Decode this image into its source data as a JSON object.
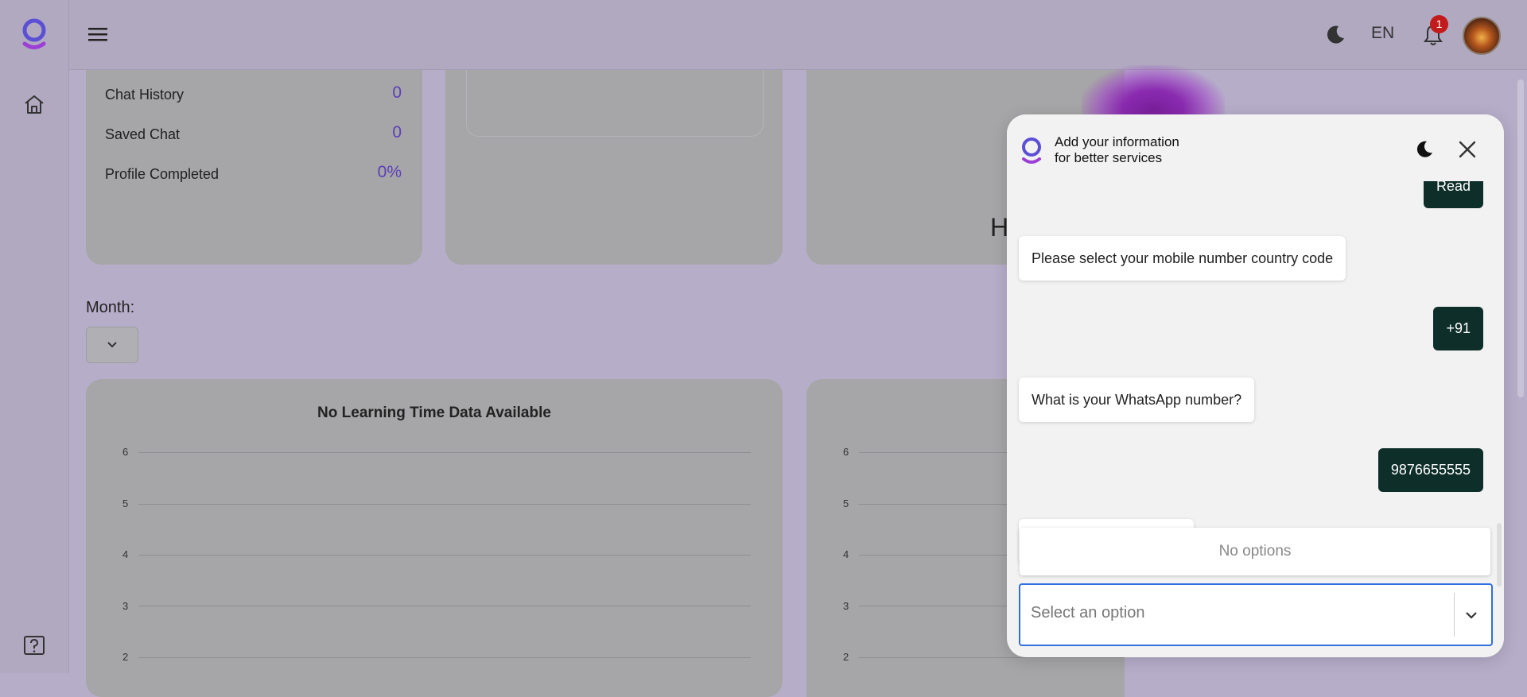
{
  "header": {
    "lang": "EN",
    "notification_count": "1"
  },
  "stats": [
    {
      "label": "Chat History",
      "value": "0"
    },
    {
      "label": "Saved Chat",
      "value": "0"
    },
    {
      "label": "Profile Completed",
      "value": "0%"
    }
  ],
  "partial_text": "H",
  "filters": {
    "month_label": "Month:"
  },
  "charts": {
    "left_title": "No Learning Time Data Available",
    "y_ticks": [
      "6",
      "5",
      "4",
      "3",
      "2"
    ]
  },
  "chart_data": [
    {
      "type": "line",
      "title": "No Learning Time Data Available",
      "series": [],
      "yticks": [
        6,
        5,
        4,
        3,
        2
      ],
      "grid": true
    },
    {
      "type": "line",
      "title": "",
      "series": [],
      "yticks": [
        6,
        5,
        4,
        3,
        2
      ],
      "grid": true
    }
  ],
  "chat": {
    "title_line1": "Add your information",
    "title_line2": "for better services",
    "messages": [
      {
        "from": "user",
        "text": "Read"
      },
      {
        "from": "bot",
        "text": "Please select your mobile number country code"
      },
      {
        "from": "user",
        "text": "+91"
      },
      {
        "from": "bot",
        "text": "What is your WhatsApp number?"
      },
      {
        "from": "user",
        "text": "9876655555"
      }
    ],
    "no_options": "No options",
    "select_placeholder": "Select an option"
  },
  "colors": {
    "accent_purple": "#5b3fb8",
    "user_bubble": "#0e2e2a",
    "badge_red": "#c21b1b",
    "focus_blue": "#2f6fe0"
  }
}
